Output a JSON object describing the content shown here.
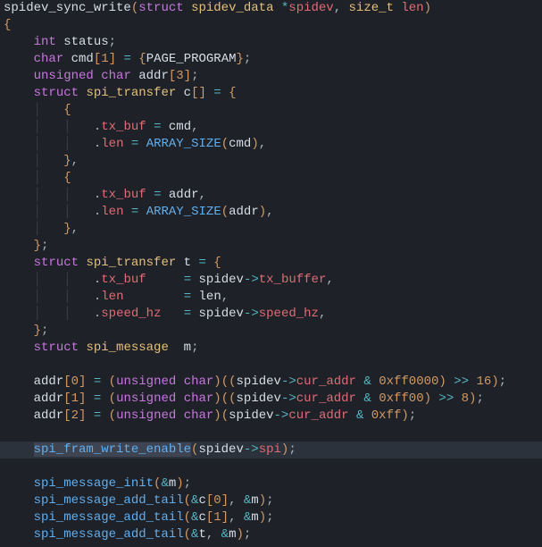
{
  "code": {
    "fn_name": "spidev_sync_write",
    "struct_kw": "struct",
    "spidev_data": "spidev_data",
    "spidev_param": "spidev",
    "size_t": "size_t",
    "len_param": "len",
    "int_kw": "int",
    "status": "status",
    "char_kw": "char",
    "cmd": "cmd",
    "one": "1",
    "page_program": "PAGE_PROGRAM",
    "unsigned_kw": "unsigned",
    "addr": "addr",
    "three": "3",
    "spi_transfer": "spi_transfer",
    "c_arr": "c",
    "tx_buf": "tx_buf",
    "len_field": "len",
    "array_size": "ARRAY_SIZE",
    "t_var": "t",
    "tx_buffer": "tx_buffer",
    "speed_hz": "speed_hz",
    "spi_message": "spi_message",
    "m_var": "m",
    "zero": "0",
    "two": "2",
    "cur_addr": "cur_addr",
    "hex_ff0000": "0xff0000",
    "hex_ff00": "0xff00",
    "hex_ff": "0xff",
    "sixteen": "16",
    "eight": "8",
    "fram_write_enable": "spi_fram_write_enable",
    "spi_field": "spi",
    "msg_init": "spi_message_init",
    "msg_add_tail": "spi_message_add_tail"
  }
}
